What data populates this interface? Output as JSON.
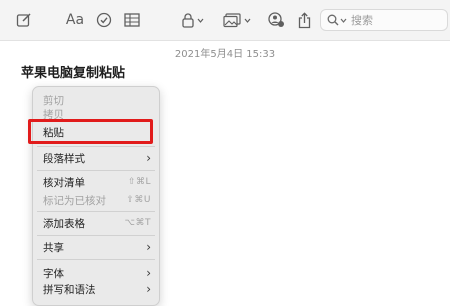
{
  "toolbar": {
    "icons": [
      "compose-icon",
      "format-text-icon",
      "checklist-icon",
      "table-icon",
      "lock-icon",
      "media-icon",
      "collaborate-icon",
      "share-icon",
      "search-icon"
    ],
    "format_label": "Aa",
    "search_placeholder": "搜索"
  },
  "note": {
    "timestamp": "2021年5月4日 15:33",
    "title": "苹果电脑复制粘贴"
  },
  "context_menu": {
    "cut": "剪切",
    "copy": "拷贝",
    "paste": "粘贴",
    "paragraph_style": "段落样式",
    "checklist": "核对清单",
    "checklist_shortcut": "⇧⌘L",
    "mark_checked": "标记为已核对",
    "mark_checked_shortcut": "⇧⌘U",
    "add_table": "添加表格",
    "add_table_shortcut": "⌥⌘T",
    "share": "共享",
    "font": "字体",
    "spelling_grammar": "拼写和语法",
    "submenu_arrow": "›"
  },
  "colors": {
    "highlight_border": "#e11b1b",
    "menu_background": "#eaeaea",
    "toolbar_background": "#f4f4f4"
  }
}
